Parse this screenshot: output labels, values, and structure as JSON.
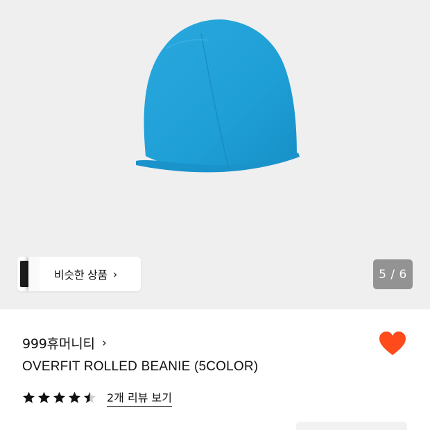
{
  "gallery": {
    "similar_label": "비슷한 상품",
    "similar_chevron": "›",
    "counter": "5 / 6",
    "current_index": 5,
    "total": 6,
    "image_icon": "beanie-product-image"
  },
  "product": {
    "brand": "999휴머니티",
    "brand_chevron": "›",
    "title": "OVERFIT ROLLED BEANIE (5COLOR)",
    "rating": 4.5,
    "rating_max": 5,
    "review_link": "2개 리뷰 보기",
    "liked": true
  },
  "colors": {
    "heart": "#ff4a1c",
    "beanie": "#1e9fd6",
    "background": "#efefef"
  }
}
